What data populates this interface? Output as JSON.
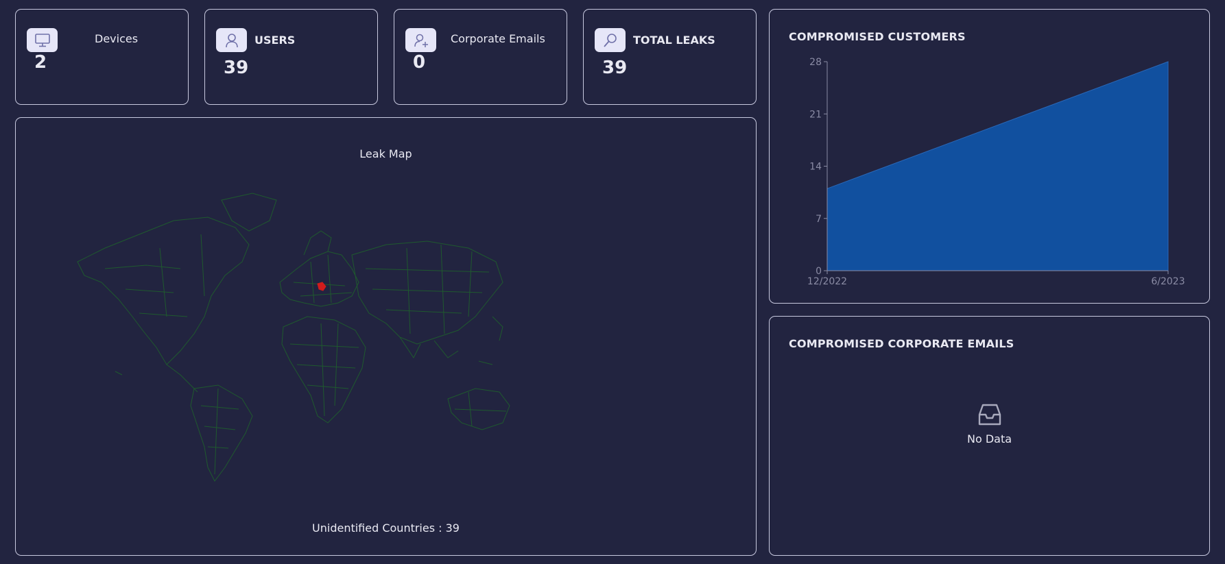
{
  "stats": {
    "devices": {
      "label": "Devices",
      "value": "2"
    },
    "users": {
      "label": "USERS",
      "value": "39"
    },
    "corporate_emails": {
      "label": "Corporate Emails",
      "value": "0"
    },
    "total_leaks": {
      "label": "TOTAL LEAKS",
      "value": "39"
    }
  },
  "map": {
    "title": "Leak Map",
    "footer": "Unidentified Countries : 39",
    "border_color": "#1f5a2e",
    "highlight_color": "#d11c1c"
  },
  "customers_panel": {
    "title": "COMPROMISED CUSTOMERS"
  },
  "emails_panel": {
    "title": "COMPROMISED CORPORATE EMAILS",
    "empty_text": "No Data",
    "icon": "inbox-icon"
  },
  "colors": {
    "background": "#222440",
    "card_border": "#c9cae0",
    "icon_bg": "#e6e6f8",
    "icon_fg": "#6f70a8",
    "area_fill": "#11509f"
  },
  "chart_data": {
    "type": "area",
    "title": "",
    "xlabel": "",
    "ylabel": "",
    "x": [
      "12/2022",
      "6/2023"
    ],
    "series": [
      {
        "values": [
          11,
          28
        ]
      }
    ],
    "ylim": [
      0,
      28
    ],
    "yticks": [
      0,
      7,
      14,
      21,
      28
    ],
    "grid": false,
    "fill_color": "#11509f"
  }
}
